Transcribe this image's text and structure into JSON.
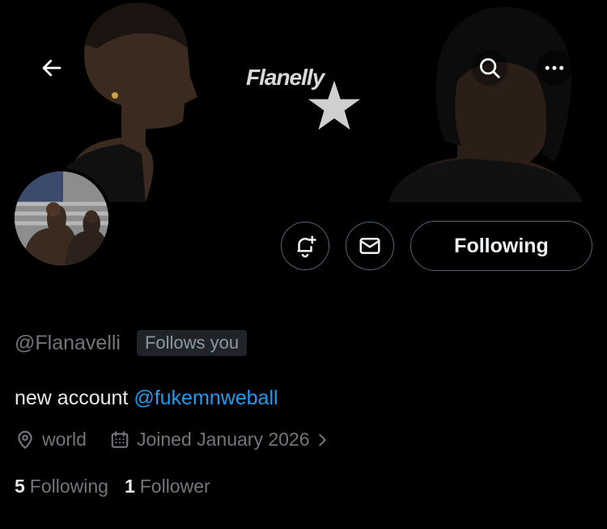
{
  "banner": {
    "logo_text": "Flanelly",
    "back_icon": "arrow-left-icon",
    "search_icon": "search-icon",
    "more_icon": "more-horizontal-icon"
  },
  "profile": {
    "handle": "@Flanavelli",
    "follows_you_badge": "Follows you",
    "bio_text": "new account ",
    "bio_mention": "@fukemnweball",
    "location": "world",
    "joined": "Joined January 2026",
    "following_count": "5",
    "following_label": "Following",
    "followers_count": "1",
    "followers_label": "Follower"
  },
  "actions": {
    "notify_icon": "bell-plus-icon",
    "message_icon": "envelope-icon",
    "following_button_label": "Following"
  },
  "colors": {
    "background": "#000000",
    "text_primary": "#e7e9ea",
    "text_secondary": "#71767b",
    "link": "#1d9bf0",
    "border": "#536471"
  }
}
